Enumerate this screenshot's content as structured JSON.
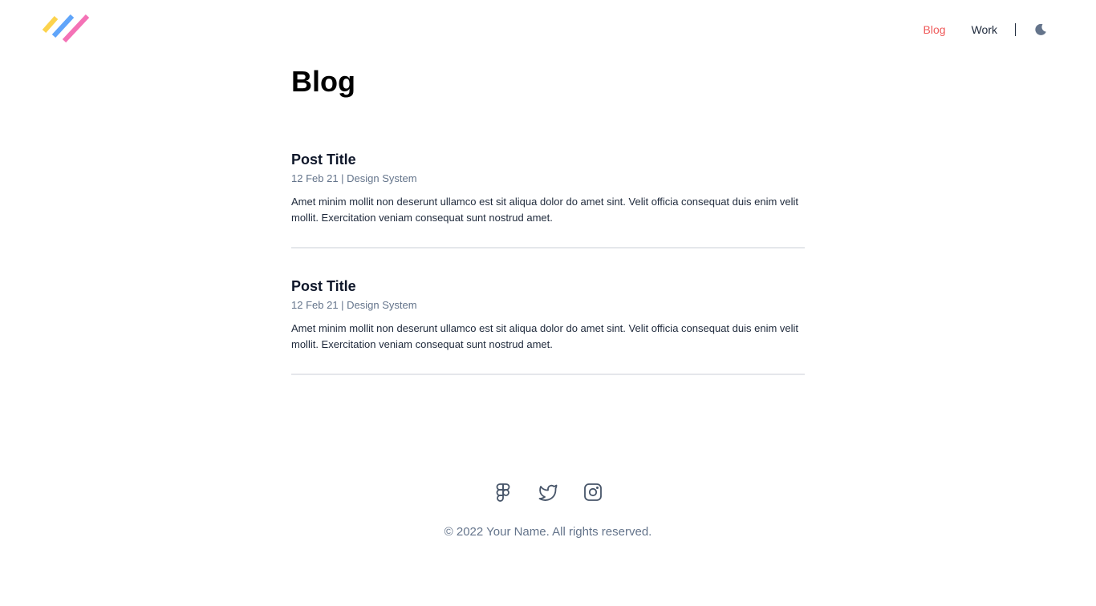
{
  "header": {
    "logo_icon": "tri-stripe-logo",
    "logo_colors": [
      "#fcd34d",
      "#60a5fa",
      "#f472b6"
    ],
    "nav": [
      {
        "label": "Blog",
        "active": true
      },
      {
        "label": "Work",
        "active": false
      }
    ],
    "divider": "|",
    "theme_toggle_icon": "moon-icon"
  },
  "main": {
    "title": "Blog",
    "posts": [
      {
        "title": "Post Title",
        "meta": "12 Feb 21 | Design System",
        "excerpt": "Amet minim mollit non deserunt ullamco est sit aliqua dolor do amet sint. Velit officia consequat duis enim velit mollit. Exercitation veniam consequat sunt nostrud amet."
      },
      {
        "title": "Post Title",
        "meta": "12 Feb 21 | Design System",
        "excerpt": "Amet minim mollit non deserunt ullamco est sit aliqua dolor do amet sint. Velit officia consequat duis enim velit mollit. Exercitation veniam consequat sunt nostrud amet."
      }
    ]
  },
  "footer": {
    "social": [
      {
        "icon": "figma-icon"
      },
      {
        "icon": "twitter-icon"
      },
      {
        "icon": "instagram-icon"
      }
    ],
    "copyright": "© 2022 Your Name. All rights reserved."
  },
  "colors": {
    "accent": "#ef5b5b",
    "text": "#0f172a",
    "muted": "#64748b",
    "divider": "#e5e7eb"
  }
}
